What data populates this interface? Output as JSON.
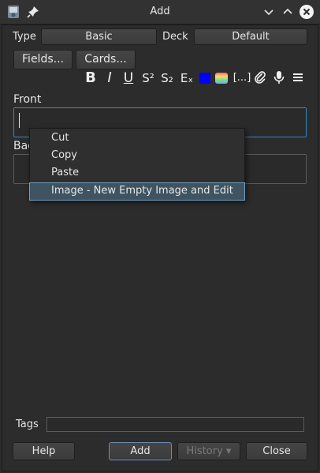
{
  "window": {
    "title": "Add"
  },
  "note": {
    "type_label": "Type",
    "type_value": "Basic",
    "deck_label": "Deck",
    "deck_value": "Default",
    "fields_button": "Fields...",
    "cards_button": "Cards..."
  },
  "toolbar": {
    "bold": "B",
    "italic": "I",
    "underline": "U",
    "superscript": "S²",
    "subscript": "S₂",
    "clear": "Eₓ",
    "cloze": "[...]",
    "text_color": "#0000ff"
  },
  "fields": [
    {
      "label": "Front",
      "value": ""
    },
    {
      "label": "Back",
      "value": ""
    }
  ],
  "context_menu": {
    "items": [
      "Cut",
      "Copy",
      "Paste",
      "Image - New Empty Image and Edit"
    ],
    "selected": "Image - New Empty Image and Edit"
  },
  "tags": {
    "label": "Tags",
    "value": ""
  },
  "buttons": {
    "help": "Help",
    "add": "Add",
    "history": "History ▾",
    "close": "Close"
  }
}
